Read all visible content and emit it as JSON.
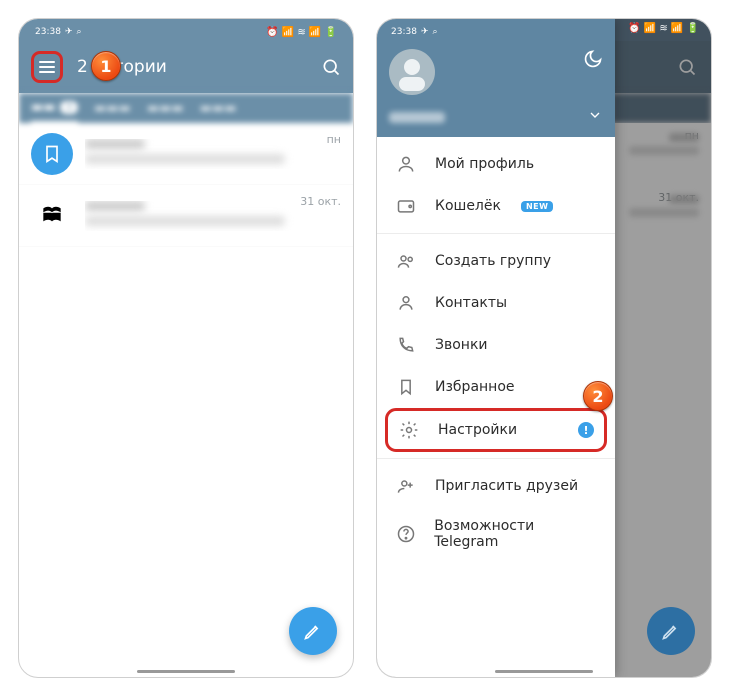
{
  "status": {
    "time": "23:38",
    "icons": "⏰ 📶 ≋ 📶 🔋"
  },
  "left": {
    "header_title": "2 истории",
    "tab_badge": "3",
    "chats": [
      {
        "time": "пн"
      },
      {
        "time": "31 окт."
      }
    ]
  },
  "callouts": {
    "one": "1",
    "two": "2"
  },
  "drawer": {
    "menu": {
      "profile": "Мой профиль",
      "wallet": "Кошелёк",
      "wallet_badge": "NEW",
      "new_group": "Создать группу",
      "contacts": "Контакты",
      "calls": "Звонки",
      "saved": "Избранное",
      "settings": "Настройки",
      "settings_dot": "!",
      "invite": "Пригласить друзей",
      "features": "Возможности Telegram"
    }
  },
  "right_backdrop": {
    "chat1_time": "пн",
    "chat2_time": "31 окт."
  }
}
